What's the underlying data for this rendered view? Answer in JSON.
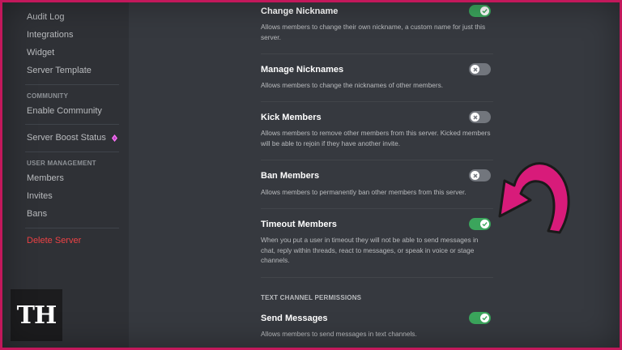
{
  "sidebar": {
    "items_top": [
      {
        "label": "Audit Log"
      },
      {
        "label": "Integrations"
      },
      {
        "label": "Widget"
      },
      {
        "label": "Server Template"
      }
    ],
    "community_header": "COMMUNITY",
    "enable_community": "Enable Community",
    "boost_status": "Server Boost Status",
    "user_management_header": "USER MANAGEMENT",
    "user_items": [
      {
        "label": "Members"
      },
      {
        "label": "Invites"
      },
      {
        "label": "Bans"
      }
    ],
    "delete_server": "Delete Server"
  },
  "permissions": [
    {
      "title": "Change Nickname",
      "desc": "Allows members to change their own nickname, a custom name for just this server.",
      "enabled": true
    },
    {
      "title": "Manage Nicknames",
      "desc": "Allows members to change the nicknames of other members.",
      "enabled": false
    },
    {
      "title": "Kick Members",
      "desc": "Allows members to remove other members from this server. Kicked members will be able to rejoin if they have another invite.",
      "enabled": false
    },
    {
      "title": "Ban Members",
      "desc": "Allows members to permanently ban other members from this server.",
      "enabled": false
    },
    {
      "title": "Timeout Members",
      "desc": "When you put a user in timeout they will not be able to send messages in chat, reply within threads, react to messages, or speak in voice or stage channels.",
      "enabled": true
    }
  ],
  "text_channel_header": "TEXT CHANNEL PERMISSIONS",
  "send_messages": {
    "title": "Send Messages",
    "desc": "Allows members to send messages in text channels.",
    "enabled": true
  },
  "logo_text": "TH",
  "colors": {
    "accent_pink": "#c2185b",
    "toggle_on": "#3ba55c",
    "toggle_off": "#72767d",
    "danger": "#ed4245"
  }
}
